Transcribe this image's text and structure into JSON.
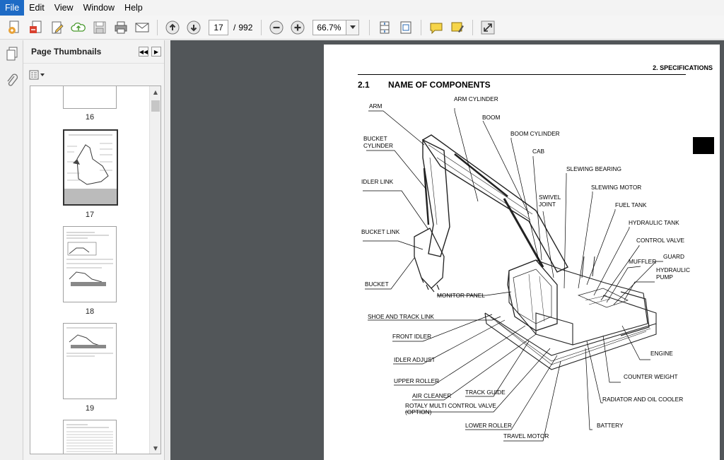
{
  "menu": [
    "File",
    "Edit",
    "View",
    "Window",
    "Help"
  ],
  "toolbar": {
    "current_page": "17",
    "page_separator": "/",
    "total_pages": "992",
    "zoom": "66.7%"
  },
  "panel": {
    "title": "Page Thumbnails",
    "thumbnails": [
      {
        "label": "16"
      },
      {
        "label": "17"
      },
      {
        "label": "18"
      },
      {
        "label": "19"
      }
    ]
  },
  "document": {
    "header": "2. SPECIFICATIONS",
    "section_number": "2.1",
    "section_title": "NAME OF COMPONENTS",
    "labels": {
      "arm": "ARM",
      "arm_cylinder": "ARM CYLINDER",
      "boom": "BOOM",
      "boom_cylinder": "BOOM CYLINDER",
      "bucket_cylinder_1": "BUCKET",
      "bucket_cylinder_2": "CYLINDER",
      "cab": "CAB",
      "slewing_bearing": "SLEWING BEARING",
      "idler_link": "IDLER LINK",
      "swivel_joint_1": "SWIVEL",
      "swivel_joint_2": "JOINT",
      "slewing_motor": "SLEWING MOTOR",
      "fuel_tank": "FUEL TANK",
      "hydraulic_tank": "HYDRAULIC TANK",
      "bucket_link": "BUCKET LINK",
      "control_valve": "CONTROL VALVE",
      "guard": "GUARD",
      "muffler": "MUFFLER",
      "hydraulic_pump_1": "HYDRAULIC",
      "hydraulic_pump_2": "PUMP",
      "bucket": "BUCKET",
      "monitor_panel": "MONITOR PANEL",
      "shoe_and_track_link": "SHOE AND TRACK LINK",
      "front_idler": "FRONT IDLER",
      "engine": "ENGINE",
      "idler_adjust": "IDLER ADJUST",
      "counter_weight": "COUNTER WEIGHT",
      "upper_roller": "UPPER ROLLER",
      "track_guide": "TRACK GUIDE",
      "air_cleaner": "AIR CLEANER",
      "radiator_and_oil_cooler": "RADIATOR AND OIL COOLER",
      "rotaly_1": "ROTALY MULTI CONTROL VALVE",
      "rotaly_2": "(OPTION)",
      "lower_roller": "LOWER ROLLER",
      "battery": "BATTERY",
      "travel_motor": "TRAVEL MOTOR"
    }
  },
  "icons": {
    "toolbar": [
      "create-pdf-icon",
      "convert-icon",
      "edit-icon",
      "upload-cloud-icon",
      "save-icon",
      "print-icon",
      "email-icon",
      "prev-page-icon",
      "next-page-icon",
      "zoom-out-icon",
      "zoom-in-icon",
      "fit-page-icon",
      "full-screen-icon",
      "comment-icon",
      "highlight-icon",
      "expand-icon"
    ]
  },
  "colors": {
    "menu_active": "#1e6bc5",
    "doc_background": "#525659",
    "accent_green": "#4a9a2f",
    "accent_blue": "#2b6bb3"
  }
}
